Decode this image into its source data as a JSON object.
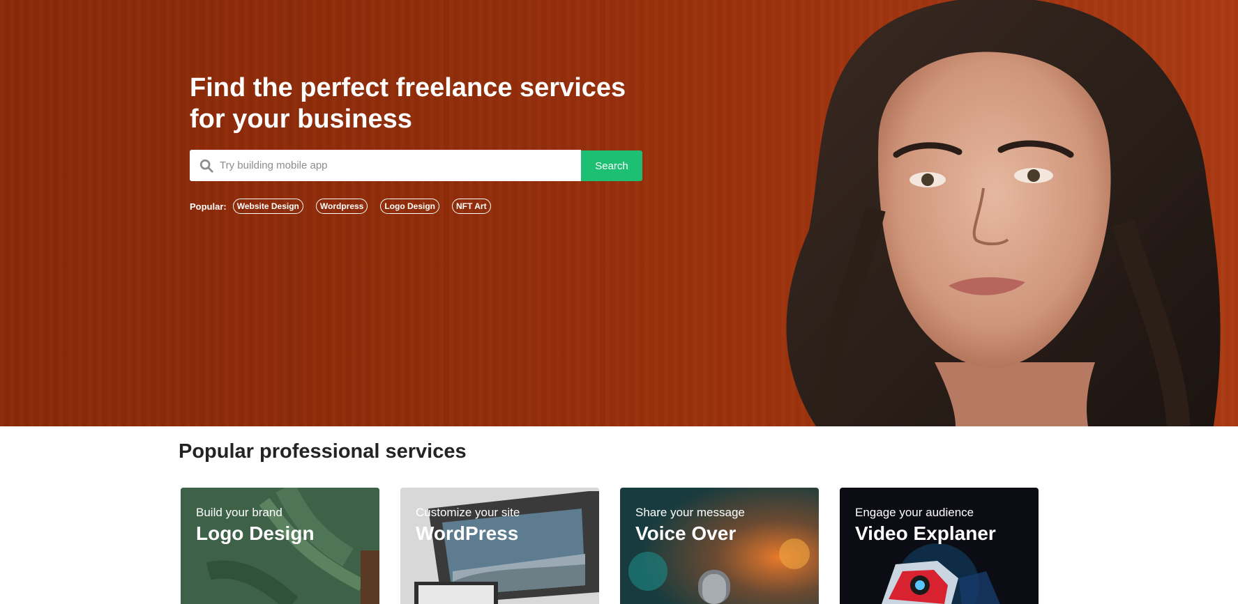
{
  "hero": {
    "title": "Find the perfect freelance services for your business",
    "background_color": "#922d0a"
  },
  "search": {
    "placeholder": "Try building mobile app",
    "value": "",
    "button_label": "Search",
    "button_color": "#1dbf73"
  },
  "popular": {
    "label": "Popular:",
    "tags": [
      "Website Design",
      "Wordpress",
      "Logo Design",
      "NFT Art"
    ]
  },
  "services": {
    "title": "Popular professional services",
    "cards": [
      {
        "subtitle": "Build your brand",
        "title": "Logo Design"
      },
      {
        "subtitle": "Customize your site",
        "title": "WordPress"
      },
      {
        "subtitle": "Share your message",
        "title": "Voice Over"
      },
      {
        "subtitle": "Engage your audience",
        "title": "Video Explaner"
      }
    ]
  }
}
